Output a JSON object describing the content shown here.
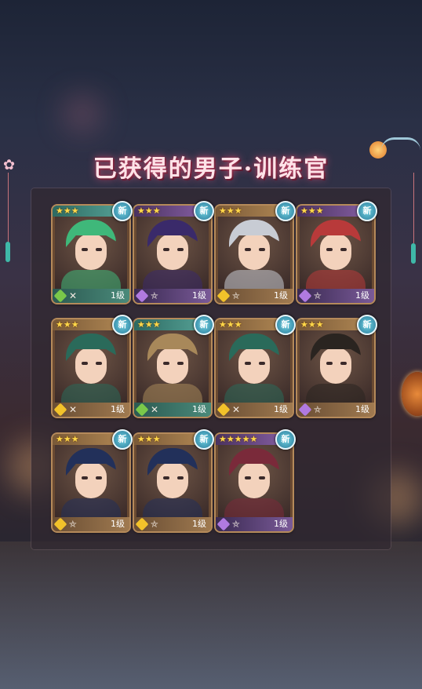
{
  "title": "已获得的男子·训练官",
  "cards": [
    {
      "stars": "★★★",
      "new": "新",
      "element": "green",
      "weapon": "✕",
      "level": "1级",
      "hair": "#3fb87a",
      "bar": "teal"
    },
    {
      "stars": "★★★",
      "new": "新",
      "element": "purple",
      "weapon": "⛤",
      "level": "1级",
      "hair": "#3a2a6a",
      "bar": "purple"
    },
    {
      "stars": "★★★",
      "new": "新",
      "element": "gold",
      "weapon": "⛤",
      "level": "1级",
      "hair": "#c8ccd4",
      "bar": "brown"
    },
    {
      "stars": "★★★",
      "new": "新",
      "element": "purple",
      "weapon": "⛤",
      "level": "1级",
      "hair": "#b83a3a",
      "bar": "purple"
    },
    {
      "stars": "★★★",
      "new": "新",
      "element": "gold",
      "weapon": "✕",
      "level": "1级",
      "hair": "#2a6a5a",
      "bar": "brown"
    },
    {
      "stars": "★★★",
      "new": "新",
      "element": "green",
      "weapon": "✕",
      "level": "1级",
      "hair": "#a8885a",
      "bar": "teal"
    },
    {
      "stars": "★★★",
      "new": "新",
      "element": "gold",
      "weapon": "✕",
      "level": "1级",
      "hair": "#2a6a5a",
      "bar": "brown"
    },
    {
      "stars": "★★★",
      "new": "新",
      "element": "purple",
      "weapon": "⛤",
      "level": "1级",
      "hair": "#2a2420",
      "bar": "brown"
    },
    {
      "stars": "★★★",
      "new": "新",
      "element": "gold",
      "weapon": "⛤",
      "level": "1级",
      "hair": "#22305a",
      "bar": "brown"
    },
    {
      "stars": "★★★",
      "new": "新",
      "element": "gold",
      "weapon": "⛤",
      "level": "1级",
      "hair": "#22305a",
      "bar": "brown"
    },
    {
      "stars": "★★★★★",
      "new": "新",
      "element": "purple",
      "weapon": "⛤",
      "level": "1级",
      "hair": "#7a2a3a",
      "bar": "purple"
    }
  ]
}
